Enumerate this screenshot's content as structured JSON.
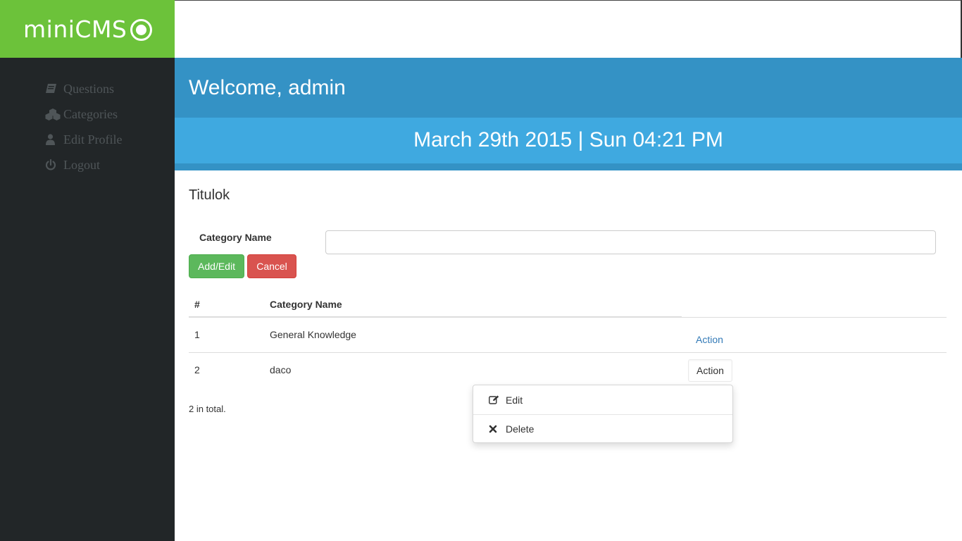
{
  "brand": {
    "name": "miniCMS",
    "accent_color": "#6cc23a"
  },
  "sidebar": {
    "items": [
      {
        "label": "Questions",
        "icon": "book-icon"
      },
      {
        "label": "Categories",
        "icon": "cubes-icon"
      },
      {
        "label": "Edit Profile",
        "icon": "user-icon"
      },
      {
        "label": "Logout",
        "icon": "power-icon"
      }
    ]
  },
  "header": {
    "welcome": "Welcome, admin",
    "datetime": "March 29th 2015 | Sun 04:21 PM"
  },
  "main": {
    "title": "Titulok",
    "form": {
      "label": "Category Name",
      "value": "",
      "add_label": "Add/Edit",
      "cancel_label": "Cancel"
    },
    "table": {
      "headers": [
        "#",
        "Category Name"
      ],
      "rows": [
        {
          "num": "1",
          "name": "General Knowledge",
          "action": "Action"
        },
        {
          "num": "2",
          "name": "daco",
          "action": "Action"
        }
      ]
    },
    "total": "2 in total."
  },
  "dropdown": {
    "items": [
      {
        "label": "Edit",
        "icon": "edit-icon"
      },
      {
        "label": "Delete",
        "icon": "times-icon"
      }
    ]
  }
}
